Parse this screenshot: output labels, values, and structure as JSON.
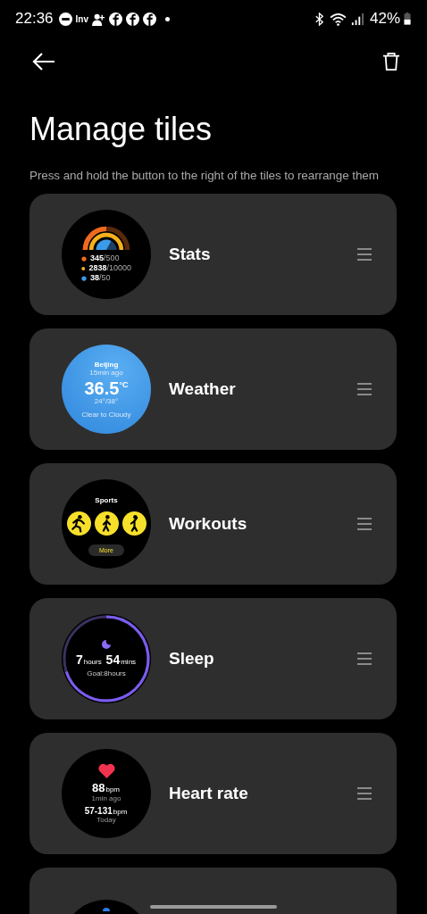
{
  "status_bar": {
    "time": "22:36",
    "app_label": "Inv",
    "battery": "42%"
  },
  "title": "Manage tiles",
  "hint": "Press and hold the button to the right of the tiles to rearrange them",
  "tiles": [
    {
      "kind": "stats",
      "name": "Stats",
      "lines": [
        {
          "value": "345",
          "goal": "/500"
        },
        {
          "value": "2838",
          "goal": "/10000"
        },
        {
          "value": "38",
          "goal": "/50"
        }
      ]
    },
    {
      "kind": "weather",
      "name": "Weather",
      "city": "Beijing",
      "updated": "15min ago",
      "temp": "36.5",
      "unit": "°C",
      "range": "24°/38°",
      "forecast": "Clear to Cloudy"
    },
    {
      "kind": "workouts",
      "name": "Workouts",
      "heading": "Sports",
      "more": "More"
    },
    {
      "kind": "sleep",
      "name": "Sleep",
      "hours": "7",
      "hours_unit": "hours",
      "mins": "54",
      "mins_unit": "mins",
      "goal": "Goal:8hours"
    },
    {
      "kind": "heart",
      "name": "Heart rate",
      "bpm": "88",
      "bpm_unit": "bpm",
      "updated": "1min ago",
      "range": "57-131",
      "range_unit": "bpm",
      "period": "Today"
    },
    {
      "kind": "partial"
    }
  ]
}
